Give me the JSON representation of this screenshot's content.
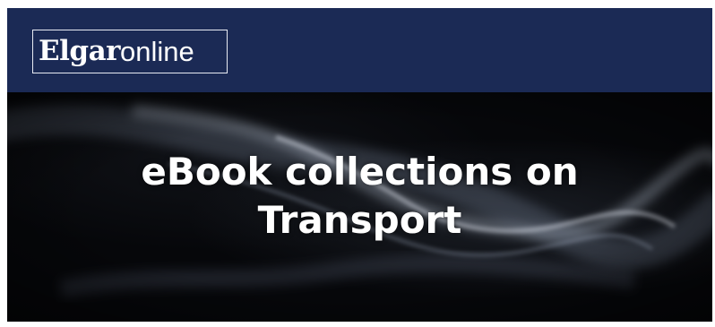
{
  "header": {
    "logo": {
      "bold_part": "Elgar",
      "light_part": "online"
    },
    "background_color": "#1b2a55"
  },
  "banner": {
    "headline_line1": "eBook collections on",
    "headline_line2": "Transport",
    "background": "dark smoke"
  }
}
